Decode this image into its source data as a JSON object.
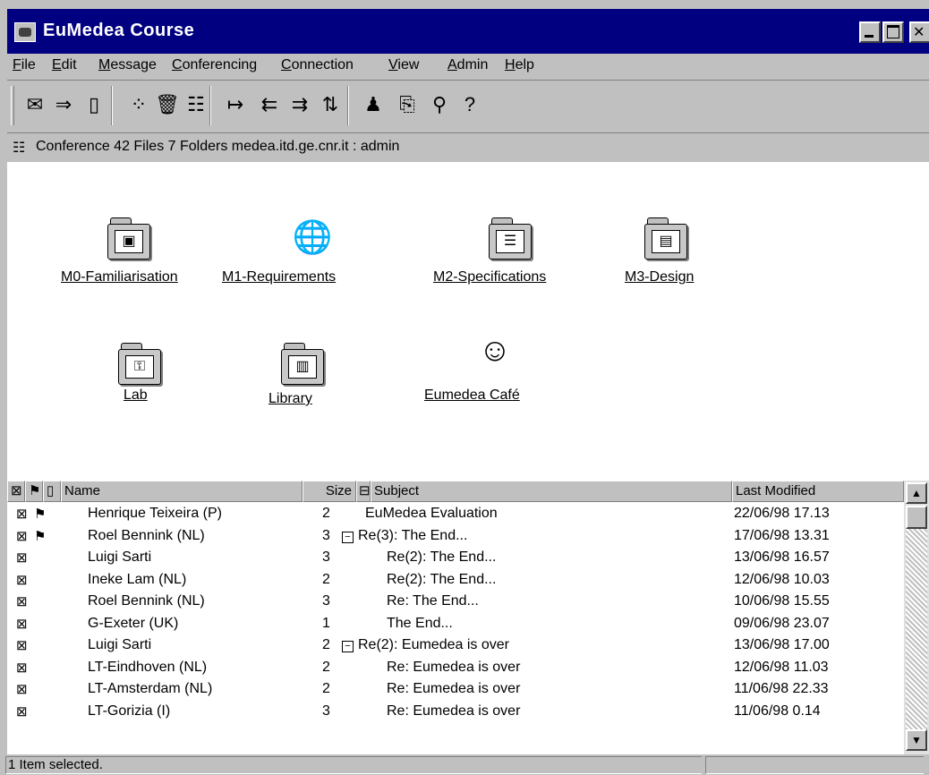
{
  "window": {
    "title": "EuMedea Course"
  },
  "menu": [
    "File",
    "Edit",
    "Message",
    "Conferencing",
    "Connection",
    "View",
    "Admin",
    "Help"
  ],
  "toolbar": [
    {
      "icon": "new-message-icon",
      "glyph": "✉"
    },
    {
      "icon": "forward-icon",
      "glyph": "⇒"
    },
    {
      "icon": "document-icon",
      "glyph": "▯"
    },
    {
      "icon": "organize-icon",
      "glyph": "⁘"
    },
    {
      "icon": "trash-icon",
      "glyph": "🗑"
    },
    {
      "icon": "properties-icon",
      "glyph": "☷"
    },
    {
      "icon": "next-icon",
      "glyph": "↦"
    },
    {
      "icon": "collapse-icon",
      "glyph": "⇇"
    },
    {
      "icon": "expand-icon",
      "glyph": "⇉"
    },
    {
      "icon": "sort-icon",
      "glyph": "⇅"
    },
    {
      "icon": "people-icon",
      "glyph": "♟"
    },
    {
      "icon": "open-folder-icon",
      "glyph": "⎘"
    },
    {
      "icon": "search-icon",
      "glyph": "⚲"
    },
    {
      "icon": "who-icon",
      "glyph": "?"
    }
  ],
  "infobar": {
    "text": "Conference   42 Files  7 Folders   medea.itd.ge.cnr.it : admin"
  },
  "folders": [
    {
      "label": "M0-Familiarisation",
      "icon": "folder-icon",
      "glyph": "▣"
    },
    {
      "label": "M1-Requirements",
      "icon": "globe-icon",
      "glyph": "🌐"
    },
    {
      "label": "M2-Specifications",
      "icon": "folder-icon",
      "glyph": "☰"
    },
    {
      "label": "M3-Design",
      "icon": "folder-icon",
      "glyph": "▤"
    },
    {
      "label": "Lab",
      "icon": "folder-icon",
      "glyph": "⚿"
    },
    {
      "label": "Library",
      "icon": "folder-icon",
      "glyph": "▥"
    },
    {
      "label": "Eumedea Café",
      "icon": "chat-icon",
      "glyph": "☺"
    }
  ],
  "columns": {
    "name": "Name",
    "size": "Size",
    "subject": "Subject",
    "modified": "Last Modified"
  },
  "rows": [
    {
      "name": "Henrique Teixeira (P)",
      "size": "2",
      "subject": "EuMedea Evaluation",
      "modified": "22/06/98  17.13",
      "flag": true,
      "expander": false,
      "indent": 0
    },
    {
      "name": "Roel Bennink (NL)",
      "size": "3",
      "subject": "Re(3): The End...",
      "modified": "17/06/98  13.31",
      "flag": true,
      "expander": true,
      "indent": 0
    },
    {
      "name": "Luigi Sarti",
      "size": "3",
      "subject": "Re(2): The End...",
      "modified": "13/06/98  16.57",
      "flag": false,
      "expander": false,
      "indent": 1
    },
    {
      "name": "Ineke Lam (NL)",
      "size": "2",
      "subject": "Re(2): The End...",
      "modified": "12/06/98  10.03",
      "flag": false,
      "expander": false,
      "indent": 1
    },
    {
      "name": "Roel Bennink (NL)",
      "size": "3",
      "subject": "Re: The End...",
      "modified": "10/06/98  15.55",
      "flag": false,
      "expander": false,
      "indent": 1
    },
    {
      "name": "G-Exeter (UK)",
      "size": "1",
      "subject": "The End...",
      "modified": "09/06/98  23.07",
      "flag": false,
      "expander": false,
      "indent": 1
    },
    {
      "name": "Luigi Sarti",
      "size": "2",
      "subject": "Re(2): Eumedea is over",
      "modified": "13/06/98  17.00",
      "flag": false,
      "expander": true,
      "indent": 0
    },
    {
      "name": "LT-Eindhoven (NL)",
      "size": "2",
      "subject": "Re: Eumedea is over",
      "modified": "12/06/98  11.03",
      "flag": false,
      "expander": false,
      "indent": 1
    },
    {
      "name": "LT-Amsterdam (NL)",
      "size": "2",
      "subject": "Re: Eumedea is over",
      "modified": "11/06/98  22.33",
      "flag": false,
      "expander": false,
      "indent": 1
    },
    {
      "name": "LT-Gorizia (I)",
      "size": "3",
      "subject": "Re: Eumedea is over",
      "modified": "11/06/98  0.14",
      "flag": false,
      "expander": false,
      "indent": 1
    }
  ],
  "status": {
    "text": "1 Item selected."
  }
}
